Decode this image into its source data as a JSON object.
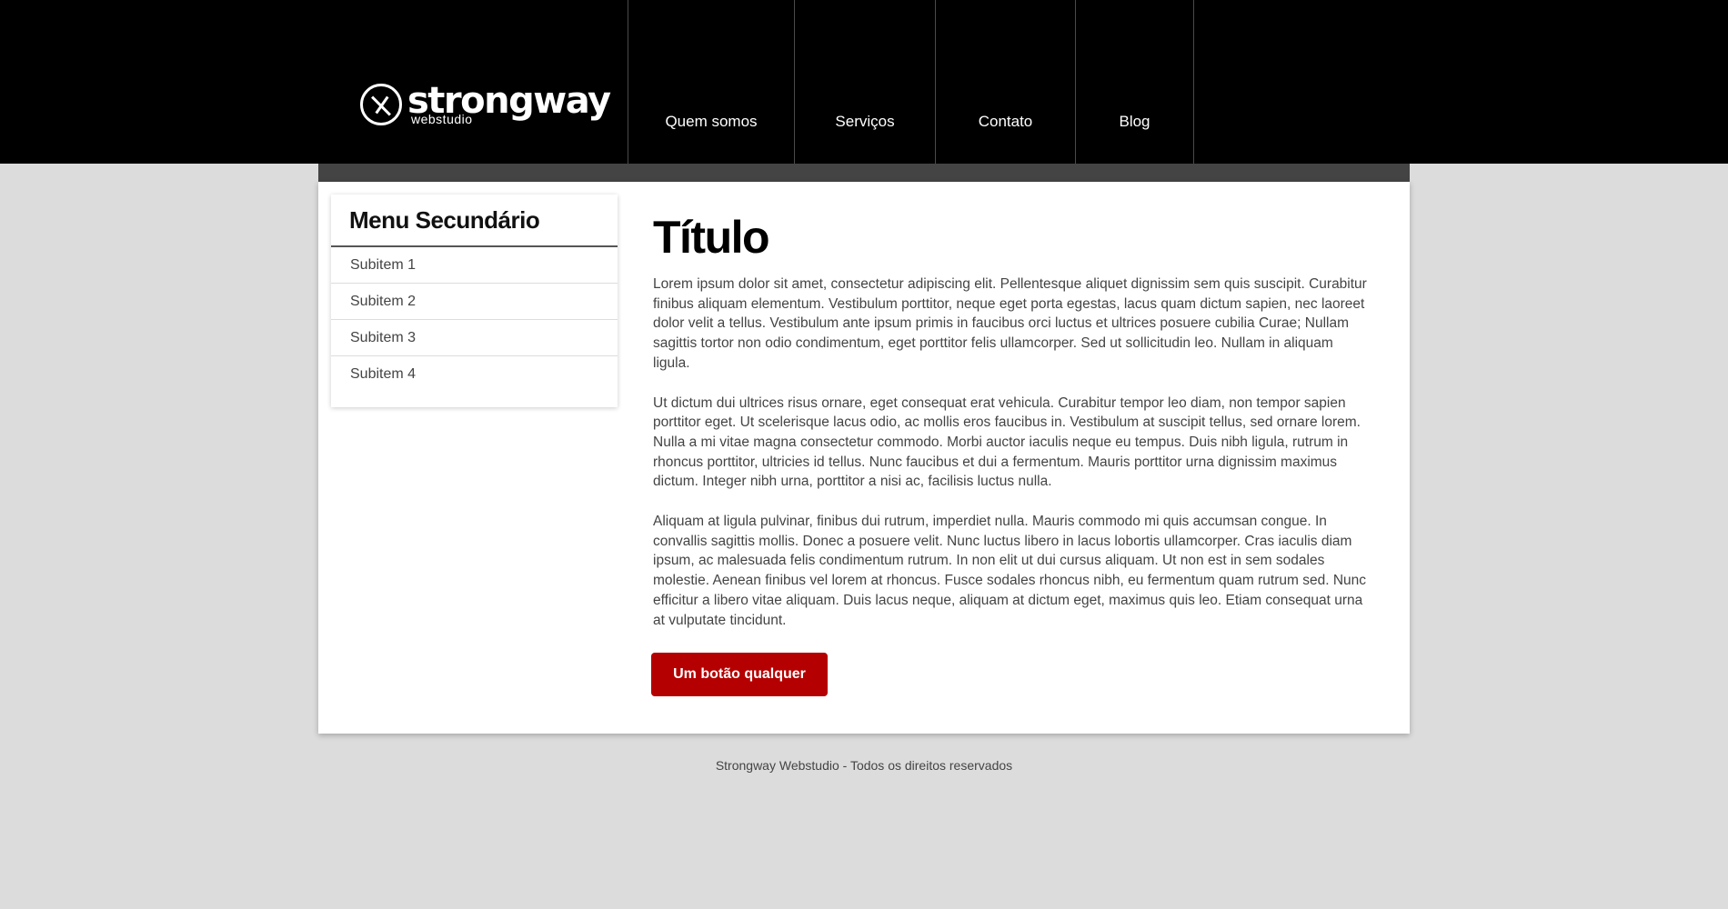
{
  "header": {
    "logo": {
      "name": "strongway",
      "tagline": "webstudio"
    },
    "nav": [
      {
        "label": "Quem somos"
      },
      {
        "label": "Serviços"
      },
      {
        "label": "Contato"
      },
      {
        "label": "Blog"
      }
    ]
  },
  "sidebar": {
    "title": "Menu Secundário",
    "items": [
      {
        "label": "Subitem 1"
      },
      {
        "label": "Subitem 2"
      },
      {
        "label": "Subitem 3"
      },
      {
        "label": "Subitem 4"
      }
    ]
  },
  "main": {
    "title": "Título",
    "paragraphs": [
      "Lorem ipsum dolor sit amet, consectetur adipiscing elit. Pellentesque aliquet dignissim sem quis suscipit. Curabitur finibus aliquam elementum. Vestibulum porttitor, neque eget porta egestas, lacus quam dictum sapien, nec laoreet dolor velit a tellus. Vestibulum ante ipsum primis in faucibus orci luctus et ultrices posuere cubilia Curae; Nullam sagittis tortor non odio condimentum, eget porttitor felis ullamcorper. Sed ut sollicitudin leo. Nullam in aliquam ligula.",
      "Ut dictum dui ultrices risus ornare, eget consequat erat vehicula. Curabitur tempor leo diam, non tempor sapien porttitor eget. Ut scelerisque lacus odio, ac mollis eros faucibus in. Vestibulum at suscipit tellus, sed ornare lorem. Nulla a mi vitae magna consectetur commodo. Morbi auctor iaculis neque eu tempus. Duis nibh ligula, rutrum in rhoncus porttitor, ultricies id tellus. Nunc faucibus et dui a fermentum. Mauris porttitor urna dignissim maximus dictum. Integer nibh urna, porttitor a nisi ac, facilisis luctus nulla.",
      "Aliquam at ligula pulvinar, finibus dui rutrum, imperdiet nulla. Mauris commodo mi quis accumsan congue. In convallis sagittis mollis. Donec a posuere velit. Nunc luctus libero in lacus lobortis ullamcorper. Cras iaculis diam ipsum, ac malesuada felis condimentum rutrum. In non elit ut dui cursus aliquam. Ut non est in sem sodales molestie. Aenean finibus vel lorem at rhoncus. Fusce sodales rhoncus nibh, eu fermentum quam rutrum sed. Nunc efficitur a libero vitae aliquam. Duis lacus neque, aliquam at dictum eget, maximus quis leo. Etiam consequat urna at vulputate tincidunt."
    ],
    "button_label": "Um botão qualquer"
  },
  "footer": {
    "text": "Strongway Webstudio - Todos os direitos reservados"
  },
  "colors": {
    "header_bg": "#000000",
    "page_bg": "#dcdcdc",
    "accent": "#b40000",
    "strip": "#444444"
  }
}
